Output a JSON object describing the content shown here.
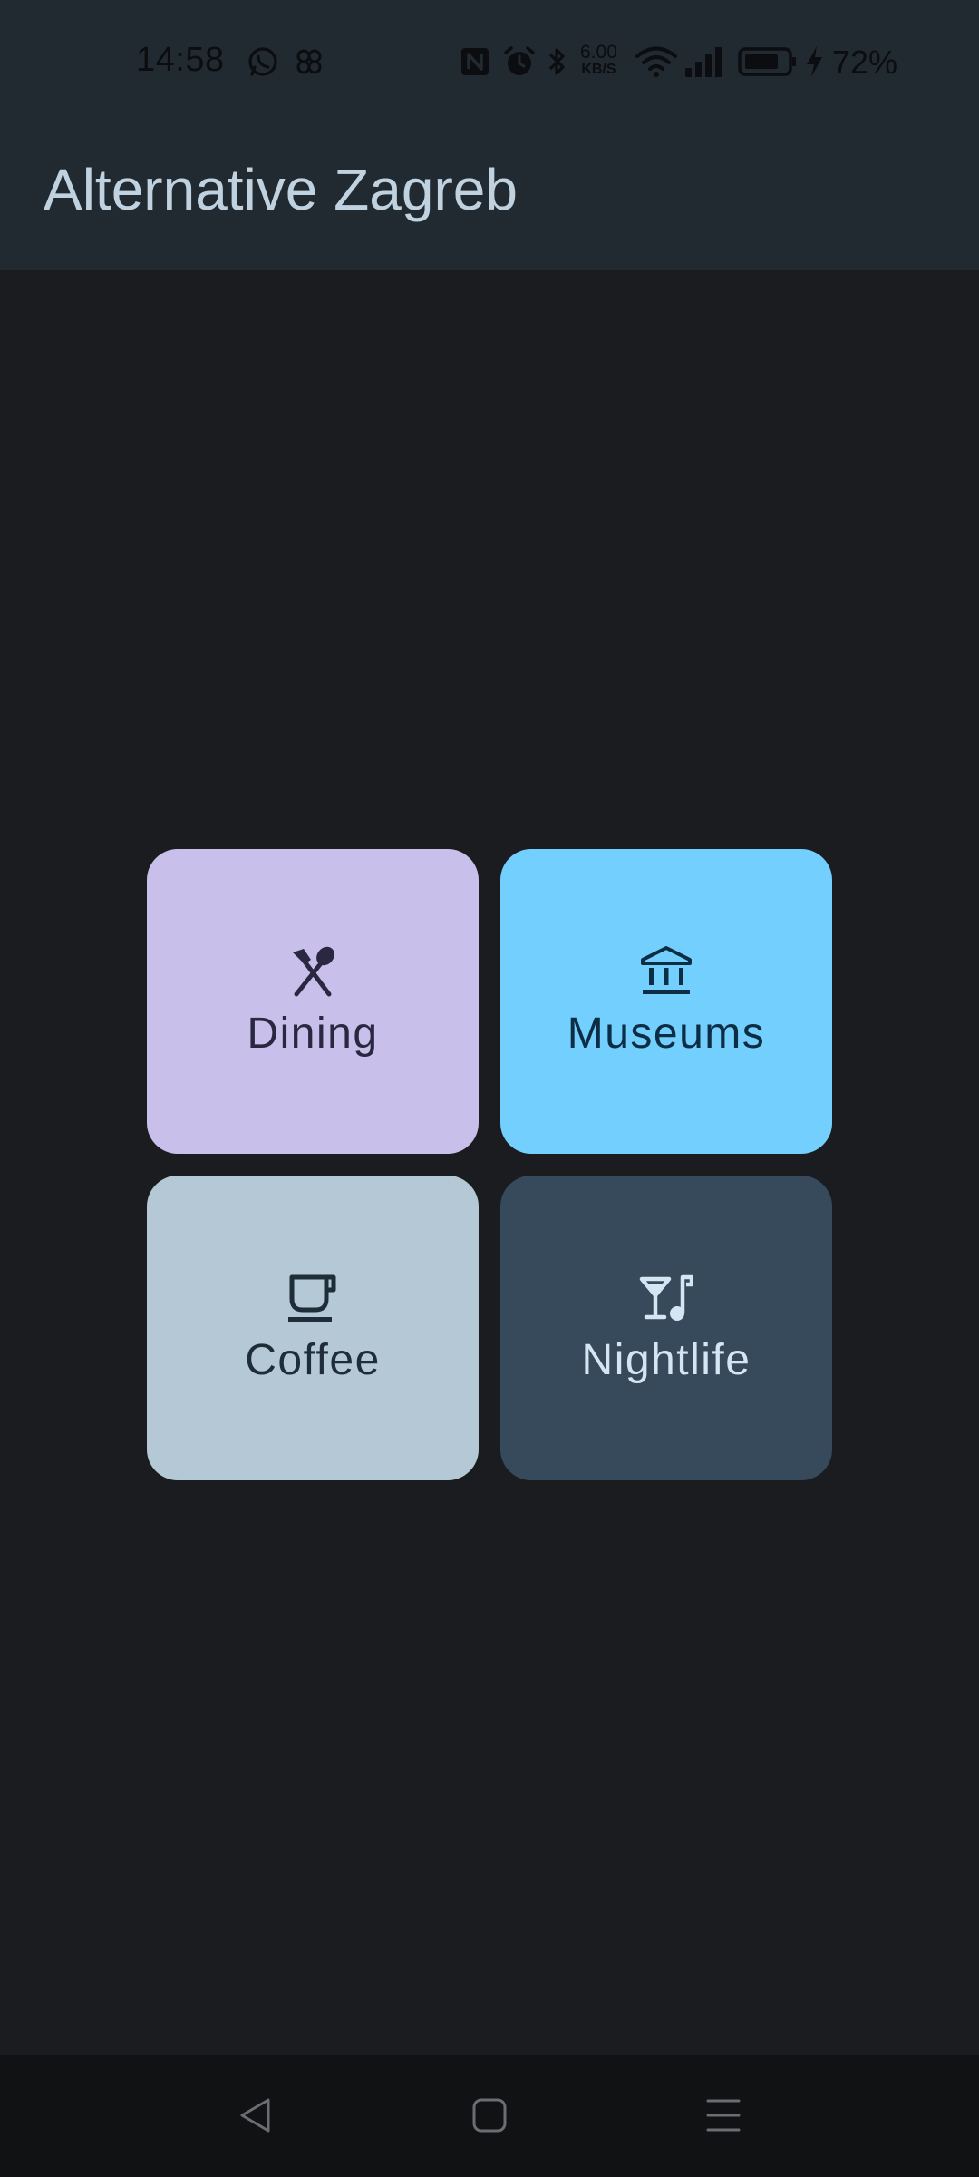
{
  "status_bar": {
    "time": "14:58",
    "net_speed_value": "6.00",
    "net_speed_unit": "KB/S",
    "battery_percent": "72%",
    "icons": [
      "whatsapp-icon",
      "pinwheel-icon",
      "nfc-icon",
      "alarm-icon",
      "bluetooth-icon",
      "wifi-icon",
      "signal-icon",
      "battery-icon",
      "charging-icon"
    ]
  },
  "app_bar": {
    "title": "Alternative Zagreb"
  },
  "categories": [
    {
      "label": "Dining",
      "icon": "dining-icon",
      "color": "#c8c0ea"
    },
    {
      "label": "Museums",
      "icon": "museum-icon",
      "color": "#73cffe"
    },
    {
      "label": "Coffee",
      "icon": "coffee-icon",
      "color": "#b4c8d6"
    },
    {
      "label": "Nightlife",
      "icon": "nightlife-icon",
      "color": "#364a5b"
    }
  ],
  "nav_bar": {
    "buttons": [
      "back-icon",
      "home-icon",
      "menu-icon"
    ]
  },
  "colors": {
    "background": "#1a1c1f",
    "app_bar": "#222a31",
    "title": "#c0d1df"
  }
}
